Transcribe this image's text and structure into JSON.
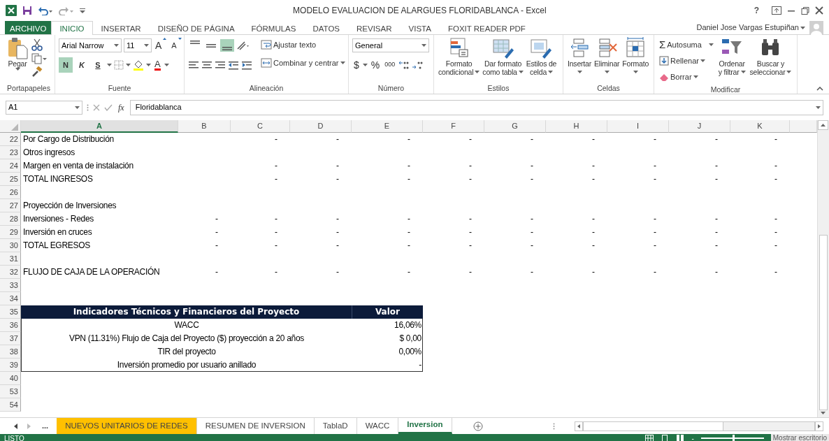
{
  "window": {
    "title": "MODELO EVALUACION DE ALARGUES FLORIDABLANCA - Excel",
    "help": "?"
  },
  "menu_tabs": [
    {
      "label": "ARCHIVO",
      "kind": "file",
      "selected": false
    },
    {
      "label": "INICIO",
      "kind": "tab",
      "selected": true
    },
    {
      "label": "INSERTAR",
      "kind": "tab",
      "selected": false
    },
    {
      "label": "DISEÑO DE PÁGINA",
      "kind": "tab",
      "selected": false
    },
    {
      "label": "FÓRMULAS",
      "kind": "tab",
      "selected": false
    },
    {
      "label": "DATOS",
      "kind": "tab",
      "selected": false
    },
    {
      "label": "REVISAR",
      "kind": "tab",
      "selected": false
    },
    {
      "label": "VISTA",
      "kind": "tab",
      "selected": false
    },
    {
      "label": "FOXIT READER PDF",
      "kind": "tab",
      "selected": false
    }
  ],
  "user": {
    "name": "Daniel Jose Vargas Estupiñan"
  },
  "clipboard": {
    "paste": "Pegar",
    "group": "Portapapeles"
  },
  "font": {
    "name": "Arial Narrow",
    "size": "11",
    "grow": "A",
    "shrink": "A",
    "color_glyph": "A",
    "group": "Fuente",
    "styles": [
      {
        "label": "N",
        "kind": "bold",
        "on": true
      },
      {
        "label": "K",
        "kind": "italic",
        "on": false
      },
      {
        "label": "S",
        "kind": "underline",
        "on": false
      }
    ]
  },
  "alignment": {
    "group": "Alineación",
    "wrap": "Ajustar texto",
    "merge": "Combinar y centrar",
    "vertical": [
      {
        "kind": "top",
        "on": false
      },
      {
        "kind": "middle",
        "on": false
      },
      {
        "kind": "bottom",
        "on": true
      }
    ]
  },
  "number": {
    "group": "Número",
    "format": "General",
    "currency": "$",
    "percent": "%",
    "thousands": "000"
  },
  "styles": {
    "group": "Estilos",
    "buttons": [
      {
        "kind": "conditional",
        "lines": [
          "Formato",
          "condicional"
        ]
      },
      {
        "kind": "table",
        "lines": [
          "Dar formato",
          "como tabla"
        ]
      },
      {
        "kind": "cellstyle",
        "lines": [
          "Estilos de",
          "celda"
        ]
      }
    ]
  },
  "cells": {
    "group": "Celdas",
    "buttons": [
      {
        "kind": "insert",
        "label": "Insertar"
      },
      {
        "kind": "delete",
        "label": "Eliminar"
      },
      {
        "kind": "format",
        "label": "Formato"
      }
    ]
  },
  "editing": {
    "group": "Modificar",
    "sum_glyph": "Σ",
    "autosum": "Autosuma",
    "fill": "Rellenar",
    "clear": "Borrar",
    "buttons": [
      {
        "kind": "sort",
        "lines": [
          "Ordenar",
          "y filtrar"
        ]
      },
      {
        "kind": "find",
        "lines": [
          "Buscar y",
          "seleccionar"
        ]
      }
    ]
  },
  "formula_bar": {
    "name_box": "A1",
    "fx": "fx",
    "value": "Floridablanca"
  },
  "columns": [
    {
      "label": "A",
      "selected": true
    },
    {
      "label": "B",
      "selected": false
    },
    {
      "label": "C",
      "selected": false
    },
    {
      "label": "D",
      "selected": false
    },
    {
      "label": "E",
      "selected": false
    },
    {
      "label": "F",
      "selected": false
    },
    {
      "label": "G",
      "selected": false
    },
    {
      "label": "H",
      "selected": false
    },
    {
      "label": "I",
      "selected": false
    },
    {
      "label": "J",
      "selected": false
    },
    {
      "label": "K",
      "selected": false
    }
  ],
  "rows": [
    {
      "number": "22",
      "kind": "data",
      "label": "Por Cargo de Distribución",
      "values": [
        "-",
        "-",
        "-",
        "-",
        "-",
        "-",
        "-",
        "-",
        "-"
      ]
    },
    {
      "number": "23",
      "kind": "data",
      "label": "Otros ingresos"
    },
    {
      "number": "24",
      "kind": "data",
      "label": "Margen en venta de instalación",
      "values": [
        "-",
        "-",
        "-",
        "-",
        "-",
        "-",
        "-",
        "-",
        "-"
      ]
    },
    {
      "number": "25",
      "kind": "data",
      "label": "TOTAL INGRESOS",
      "values": [
        "-",
        "-",
        "-",
        "-",
        "-",
        "-",
        "-",
        "-",
        "-"
      ]
    },
    {
      "number": "26",
      "kind": "data"
    },
    {
      "number": "27",
      "kind": "data",
      "label": "Proyección de Inversiones"
    },
    {
      "number": "28",
      "kind": "data",
      "label": "Inversiones - Redes",
      "values": [
        "-",
        "-",
        "-",
        "-",
        "-",
        "-",
        "-",
        "-",
        "-",
        "-"
      ]
    },
    {
      "number": "29",
      "kind": "data",
      "label": "Inversión en cruces",
      "values": [
        "-",
        "-",
        "-",
        "-",
        "-",
        "-",
        "-",
        "-",
        "-",
        "-"
      ]
    },
    {
      "number": "30",
      "kind": "data",
      "label": "TOTAL EGRESOS",
      "values": [
        "-",
        "-",
        "-",
        "-",
        "-",
        "-",
        "-",
        "-",
        "-",
        "-"
      ]
    },
    {
      "number": "31",
      "kind": "data"
    },
    {
      "number": "32",
      "kind": "data",
      "label": "FLUJO DE CAJA DE LA OPERACIÓN",
      "values": [
        "-",
        "-",
        "-",
        "-",
        "-",
        "-",
        "-",
        "-",
        "-",
        "-"
      ]
    },
    {
      "number": "33",
      "kind": "data"
    },
    {
      "number": "34",
      "kind": "data"
    },
    {
      "number": "35",
      "kind": "indicator_header",
      "label": "Indicadores Técnicos y Financieros del Proyecto",
      "value": "Valor"
    },
    {
      "number": "36",
      "kind": "indicator",
      "label": "WACC",
      "value": "16,06%"
    },
    {
      "number": "37",
      "kind": "indicator",
      "label": "VPN (11.31%) Flujo de Caja del Proyecto ($) proyección a 20 años",
      "value": "$ 0,00"
    },
    {
      "number": "38",
      "kind": "indicator",
      "label": "TIR del proyecto",
      "value": "0,00%"
    },
    {
      "number": "39",
      "kind": "indicator",
      "label": "Inversión promedio por usuario anillado",
      "value": "-"
    },
    {
      "number": "40",
      "kind": "data"
    },
    {
      "number": "53",
      "kind": "data"
    },
    {
      "number": "54",
      "kind": "data"
    }
  ],
  "sheet_nav": {
    "more": "..."
  },
  "sheet_tabs": [
    {
      "label": "NUEVOS UNITARIOS DE REDES",
      "selected": false,
      "color": "#ffc000"
    },
    {
      "label": "RESUMEN DE INVERSION",
      "selected": false
    },
    {
      "label": "TablaD",
      "selected": false
    },
    {
      "label": "WACC",
      "selected": false
    },
    {
      "label": "Inversion",
      "selected": true
    }
  ],
  "status_bar": {
    "text": "LISTO",
    "zoom_minus": "-",
    "zoom": {
      "level": 0.5
    },
    "tooltip": "Mostrar escritorio"
  }
}
